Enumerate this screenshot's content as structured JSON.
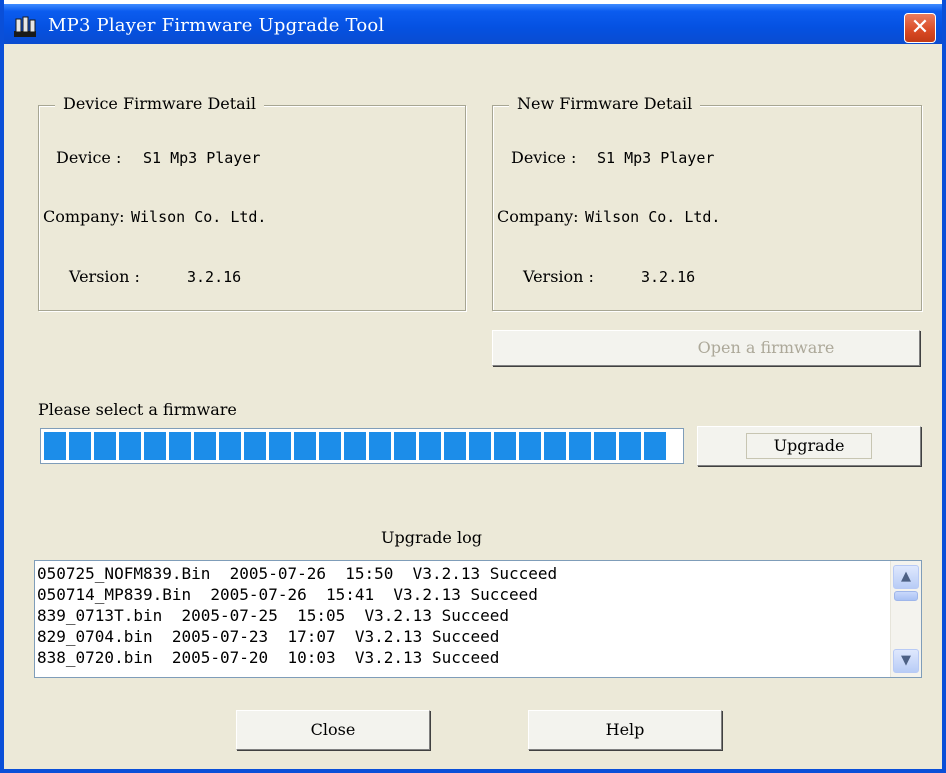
{
  "window": {
    "title": "MP3 Player  Firmware Upgrade Tool",
    "close_label": "✕"
  },
  "device_group": {
    "legend": "Device Firmware Detail",
    "device_label": "Device :",
    "device_value": "S1 Mp3 Player",
    "company_label": "Company:",
    "company_value": "Wilson Co. Ltd.",
    "version_label": "Version  :",
    "version_value": "3.2.16"
  },
  "new_group": {
    "legend": "New Firmware Detail",
    "device_label": "Device :",
    "device_value": "S1 Mp3 Player",
    "company_label": "Company:",
    "company_value": "Wilson Co. Ltd.",
    "version_label": "Version  :",
    "version_value": "3.2.16"
  },
  "buttons": {
    "open_firmware": "Open a firmware",
    "upgrade": "Upgrade",
    "close": "Close",
    "help": "Help"
  },
  "status": {
    "text": "Please select a  firmware"
  },
  "progress": {
    "percent": 100
  },
  "log": {
    "title": "Upgrade log",
    "lines": [
      "050725_NOFM839.Bin  2005-07-26  15:50  V3.2.13 Succeed",
      "050714_MP839.Bin  2005-07-26  15:41  V3.2.13 Succeed",
      "839_0713T.bin  2005-07-25  15:05  V3.2.13 Succeed",
      "829_0704.bin  2005-07-23  17:07  V3.2.13 Succeed",
      "838_0720.bin  2005-07-20  10:03  V3.2.13 Succeed"
    ]
  },
  "colors": {
    "titlebar": "#0551e1",
    "progress": "#1c8de9",
    "dialog": "#ece9d8"
  }
}
